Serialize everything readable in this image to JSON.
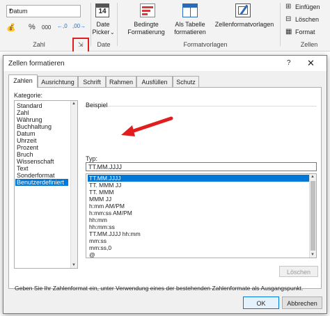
{
  "ribbon": {
    "number_format_value": "Datum",
    "zahl_icons": {
      "accounting": "💰",
      "percent": "%",
      "thousands": "000",
      "inc_decimal": "←,0",
      "dec_decimal": ",00→"
    },
    "group_zahl": "Zahl",
    "date_picker_label1": "Date",
    "date_picker_label2": "Picker",
    "date_picker_dd": "⌄",
    "calendar_day": "14",
    "group_date": "Date",
    "bedingte_line1": "Bedingte",
    "bedingte_line2": "Formatierung",
    "als_tabelle_line1": "Als Tabelle",
    "als_tabelle_line2": "formatieren",
    "zellenformat": "Zellenformatvorlagen",
    "group_formatvorlagen": "Formatvorlagen",
    "einfuegen": "Einfügen",
    "loeschen": "Löschen",
    "format": "Format",
    "group_zellen": "Zellen",
    "launcher_glyph": "⇲"
  },
  "dialog": {
    "title": "Zellen formatieren",
    "help": "?",
    "close": "✕",
    "tabs": [
      "Zahlen",
      "Ausrichtung",
      "Schrift",
      "Rahmen",
      "Ausfüllen",
      "Schutz"
    ],
    "kategorie_label": "Kategorie:",
    "kategorien": [
      "Standard",
      "Zahl",
      "Währung",
      "Buchhaltung",
      "Datum",
      "Uhrzeit",
      "Prozent",
      "Bruch",
      "Wissenschaft",
      "Text",
      "Sonderformat",
      "Benutzerdefiniert"
    ],
    "beispiel_label": "Beispiel",
    "typ_label": "Typ:",
    "typ_value": "TT.MM.JJJJ",
    "formats": [
      "TT.MM.JJJJ",
      "TT. MMM JJ",
      "TT. MMM",
      "MMM JJ",
      "h:mm AM/PM",
      "h:mm:ss AM/PM",
      "hh:mm",
      "hh:mm:ss",
      "TT.MM.JJJJ hh:mm",
      "mm:ss",
      "mm:ss,0",
      "@"
    ],
    "loeschen_button": "Löschen",
    "description": "Geben Sie Ihr Zahlenformat ein, unter Verwendung eines der bestehenden Zahlenformate als Ausgangspunkt.",
    "ok": "OK",
    "cancel": "Abbrechen"
  },
  "colors": {
    "selection": "#0078d7",
    "annotation_red": "#e21d1d"
  }
}
